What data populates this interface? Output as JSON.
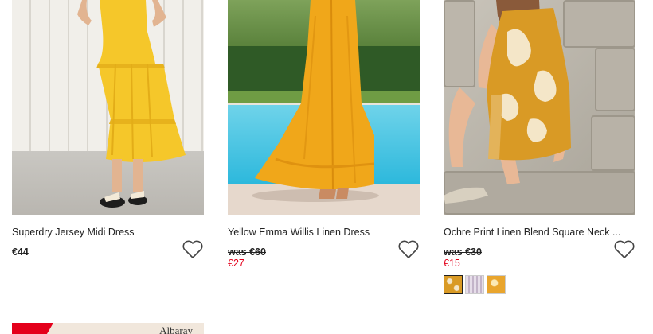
{
  "products": [
    {
      "name": "Superdry Jersey Midi Dress",
      "price": "€44",
      "photo_icon": "yellow-tiered-dress-photo"
    },
    {
      "name": "Yellow Emma Willis Linen Dress",
      "was_price": "was €60",
      "sale_price": "€27",
      "photo_icon": "yellow-maxi-dress-photo"
    },
    {
      "name": "Ochre Print Linen Blend Square Neck ...",
      "was_price": "was €30",
      "sale_price": "€15",
      "photo_icon": "ochre-print-dress-photo",
      "swatches": [
        "ochre print",
        "lilac stripe",
        "yellow print"
      ]
    }
  ],
  "next_row": {
    "brand_text": "Albaray"
  },
  "colors": {
    "sale_red": "#e4001b",
    "text": "#222222",
    "dress_yellow": "#f5c72a",
    "dress_amber": "#f0a71a",
    "ochre": "#d99a25"
  }
}
